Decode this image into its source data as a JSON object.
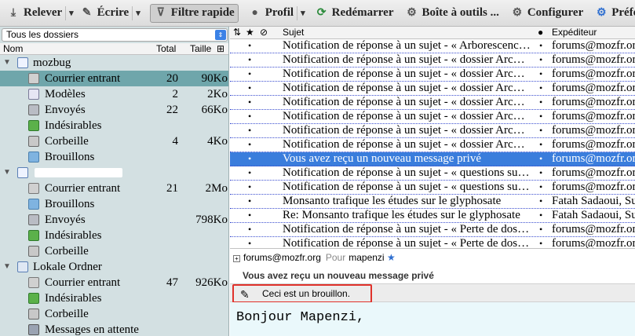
{
  "toolbar": {
    "get_messages": "Relever",
    "write": "Écrire",
    "quick_filter": "Filtre rapide",
    "profile": "Profil",
    "restart": "Redémarrer",
    "toolbox": "Boîte à outils ...",
    "configure": "Configurer",
    "preferences": "Préférences"
  },
  "folder_pane": {
    "view_select": "Tous les dossiers",
    "columns": {
      "name": "Nom",
      "total": "Total",
      "size": "Taille"
    },
    "folders": [
      {
        "name": "mozbug",
        "type": "account",
        "total": "",
        "size": ""
      },
      {
        "name": "Courrier entrant",
        "type": "inbox",
        "total": "20",
        "size": "90Ko"
      },
      {
        "name": "Modèles",
        "type": "templates",
        "total": "2",
        "size": "2Ko"
      },
      {
        "name": "Envoyés",
        "type": "sent",
        "total": "22",
        "size": "66Ko"
      },
      {
        "name": "Indésirables",
        "type": "junk",
        "total": "",
        "size": ""
      },
      {
        "name": "Corbeille",
        "type": "trash",
        "total": "4",
        "size": "4Ko"
      },
      {
        "name": "Brouillons",
        "type": "drafts",
        "total": "",
        "size": ""
      },
      {
        "name": "",
        "type": "account",
        "total": "",
        "size": ""
      },
      {
        "name": "Courrier entrant",
        "type": "inbox",
        "total": "21",
        "size": "2Mo"
      },
      {
        "name": "Brouillons",
        "type": "drafts",
        "total": "",
        "size": ""
      },
      {
        "name": "Envoyés",
        "type": "sent",
        "total": "",
        "size": "798Ko"
      },
      {
        "name": "Indésirables",
        "type": "junk",
        "total": "",
        "size": ""
      },
      {
        "name": "Corbeille",
        "type": "trash",
        "total": "",
        "size": ""
      },
      {
        "name": "Lokale Ordner",
        "type": "local",
        "total": "",
        "size": ""
      },
      {
        "name": "Courrier entrant",
        "type": "inbox",
        "total": "47",
        "size": "926Ko"
      },
      {
        "name": "Indésirables",
        "type": "junk",
        "total": "",
        "size": ""
      },
      {
        "name": "Corbeille",
        "type": "trash",
        "total": "",
        "size": ""
      },
      {
        "name": "Messages en attente",
        "type": "outbox",
        "total": "",
        "size": ""
      }
    ]
  },
  "message_list": {
    "columns": {
      "subject": "Sujet",
      "sender": "Expéditeur"
    },
    "messages": [
      {
        "subject": "Notification de réponse à un sujet - « Arborescences des...",
        "sender": "forums@mozfr.org"
      },
      {
        "subject": "Notification de réponse à un sujet - « dossier Archives v...",
        "sender": "forums@mozfr.org"
      },
      {
        "subject": "Notification de réponse à un sujet - « dossier Archives v...",
        "sender": "forums@mozfr.org"
      },
      {
        "subject": "Notification de réponse à un sujet - « dossier Archives v...",
        "sender": "forums@mozfr.org"
      },
      {
        "subject": "Notification de réponse à un sujet - « dossier Archives v...",
        "sender": "forums@mozfr.org"
      },
      {
        "subject": "Notification de réponse à un sujet - « dossier Archives v...",
        "sender": "forums@mozfr.org"
      },
      {
        "subject": "Notification de réponse à un sujet - « dossier Archives v...",
        "sender": "forums@mozfr.org"
      },
      {
        "subject": "Notification de réponse à un sujet - « dossier Archives v...",
        "sender": "forums@mozfr.org"
      },
      {
        "subject": "Vous avez reçu un nouveau message privé",
        "sender": "forums@mozfr.org"
      },
      {
        "subject": "Notification de réponse à un sujet - « questions sur l'int...",
        "sender": "forums@mozfr.org"
      },
      {
        "subject": "Notification de réponse à un sujet - « questions sur l'int...",
        "sender": "forums@mozfr.org"
      },
      {
        "subject": "Monsanto trafique les études sur le glyphosate",
        "sender": "Fatah Sadaoui, Sum"
      },
      {
        "subject": "Re: Monsanto trafique les études sur le glyphosate",
        "sender": "Fatah Sadaoui, Sum"
      },
      {
        "subject": "Notification de réponse à un sujet - « Perte de dossiers s...",
        "sender": "forums@mozfr.org"
      },
      {
        "subject": "Notification de réponse à un sujet - « Perte de dossiers s...",
        "sender": "forums@mozfr.org"
      }
    ]
  },
  "preview": {
    "from": "forums@mozfr.org",
    "to_label": "Pour",
    "to": "mapenzi",
    "subject": "Vous avez reçu un nouveau message privé",
    "draft_notice": "Ceci est un brouillon.",
    "body": "Bonjour Mapenzi,"
  },
  "colors": {
    "folder_pane_bg": "#d3e0e2",
    "selected_folder": "#6fa6ab",
    "selected_message": "#3a7ddc",
    "draft_highlight": "#e0322b",
    "body_bg": "#eaf8fb"
  }
}
